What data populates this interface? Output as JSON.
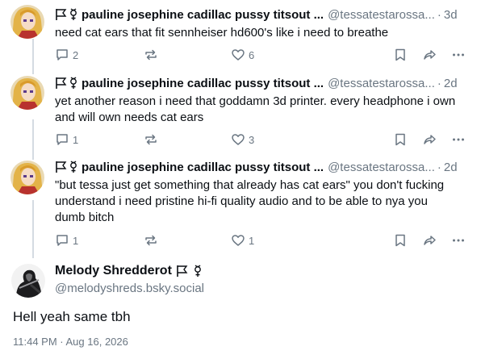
{
  "replies": [
    {
      "author": "pauline josephine cadillac pussy titsout ...",
      "handle": "@tessatestarossa...",
      "time": "3d",
      "text": "need cat ears that fit sennheiser hd600's like i need to breathe",
      "replies_count": "2",
      "likes_count": "6"
    },
    {
      "author": "pauline josephine cadillac pussy titsout ...",
      "handle": "@tessatestarossa...",
      "time": "2d",
      "text": "yet another reason i need that goddamn 3d printer. every headphone i own and will own needs cat ears",
      "replies_count": "1",
      "likes_count": "3"
    },
    {
      "author": "pauline josephine cadillac pussy titsout ...",
      "handle": "@tessatestarossa...",
      "time": "2d",
      "text": "\"but tessa just get something that already has cat ears\" you don't fucking understand i need pristine hi-fi quality audio and to be able to nya you dumb bitch",
      "replies_count": "1",
      "likes_count": "1"
    }
  ],
  "main_post": {
    "author": "Melody Shredderot",
    "handle": "@melodyshreds.bsky.social",
    "text": "Hell yeah same tbh",
    "timestamp": "11:44 PM · Aug 16, 2026"
  },
  "icons": {
    "reply": "reply-bubble-icon",
    "repost": "repost-icon",
    "like": "heart-icon",
    "bookmark": "bookmark-icon",
    "share": "share-icon",
    "more": "more-icon",
    "flag": "flag-icon",
    "symbol": "gender-symbol-icon"
  },
  "colors": {
    "text": "#0b0f14",
    "muted": "#6a7682",
    "rail": "#d4dbe2"
  }
}
